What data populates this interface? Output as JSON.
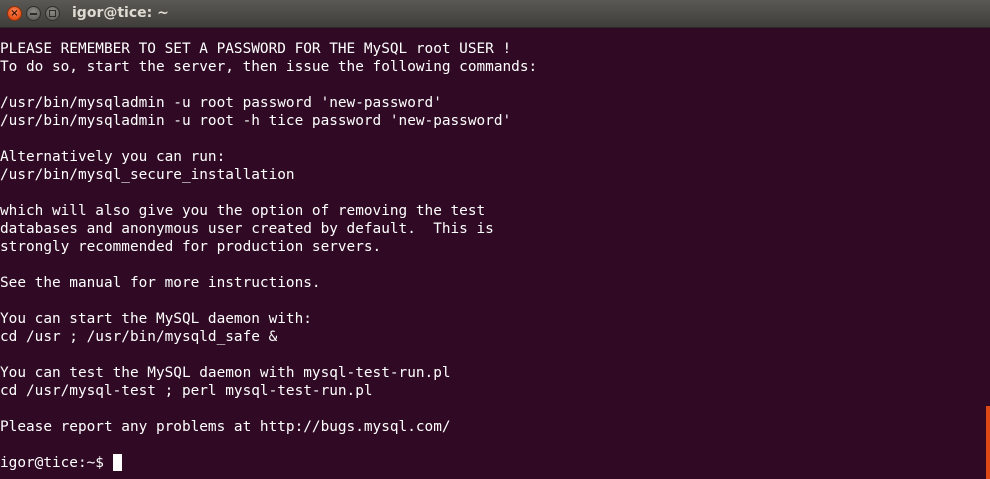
{
  "window": {
    "title": "igor@tice: ~",
    "close_glyph": "×",
    "controls": [
      "close-icon",
      "minimize-icon",
      "maximize-icon"
    ]
  },
  "colors": {
    "terminal_bg": "#300a24",
    "terminal_fg": "#ffffff",
    "scroll_thumb": "#dd4814",
    "close_button": "#e9571f"
  },
  "terminal": {
    "lines": [
      "PLEASE REMEMBER TO SET A PASSWORD FOR THE MySQL root USER !",
      "To do so, start the server, then issue the following commands:",
      "",
      "/usr/bin/mysqladmin -u root password 'new-password'",
      "/usr/bin/mysqladmin -u root -h tice password 'new-password'",
      "",
      "Alternatively you can run:",
      "/usr/bin/mysql_secure_installation",
      "",
      "which will also give you the option of removing the test",
      "databases and anonymous user created by default.  This is",
      "strongly recommended for production servers.",
      "",
      "See the manual for more instructions.",
      "",
      "You can start the MySQL daemon with:",
      "cd /usr ; /usr/bin/mysqld_safe &",
      "",
      "You can test the MySQL daemon with mysql-test-run.pl",
      "cd /usr/mysql-test ; perl mysql-test-run.pl",
      "",
      "Please report any problems at http://bugs.mysql.com/",
      ""
    ],
    "prompt": "igor@tice:~$"
  }
}
